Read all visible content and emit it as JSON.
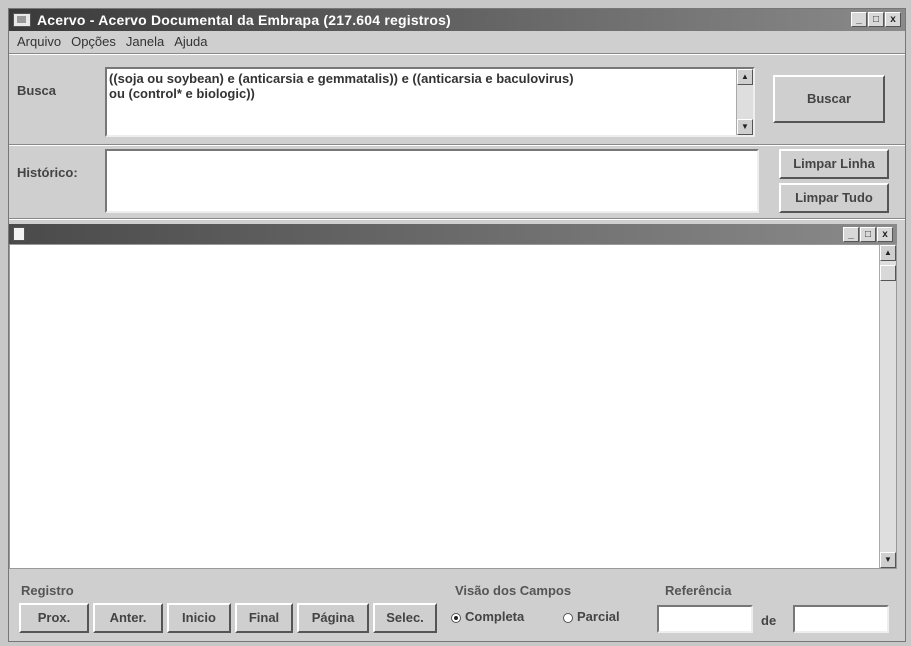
{
  "window": {
    "title": "Acervo - Acervo Documental da Embrapa (217.604 registros)",
    "controls": {
      "minimize": "_",
      "maximize": "□",
      "close": "x"
    }
  },
  "menubar": {
    "items": [
      {
        "label": "Arquivo"
      },
      {
        "label": "Opções"
      },
      {
        "label": "Janela"
      },
      {
        "label": "Ajuda"
      }
    ]
  },
  "search": {
    "label": "Busca",
    "query": "((soja ou soybean) e (anticarsia e gemmatalis)) e ((anticarsia e baculovirus)\nou (control* e biologic))",
    "button": "Buscar"
  },
  "history": {
    "label": "Histórico:",
    "value": "",
    "clear_line": "Limpar Linha",
    "clear_all": "Limpar Tudo"
  },
  "child_window": {
    "controls": {
      "minimize": "_",
      "maximize": "□",
      "close": "x"
    },
    "content": ""
  },
  "footer": {
    "registro": {
      "label": "Registro",
      "buttons": [
        "Prox.",
        "Anter.",
        "Inicio",
        "Final",
        "Página",
        "Selec."
      ]
    },
    "visao": {
      "label": "Visão dos Campos",
      "options": [
        "Completa",
        "Parcial"
      ],
      "selected": "Completa"
    },
    "referencia": {
      "label": "Referência",
      "from": "",
      "sep": "de",
      "to": ""
    }
  }
}
